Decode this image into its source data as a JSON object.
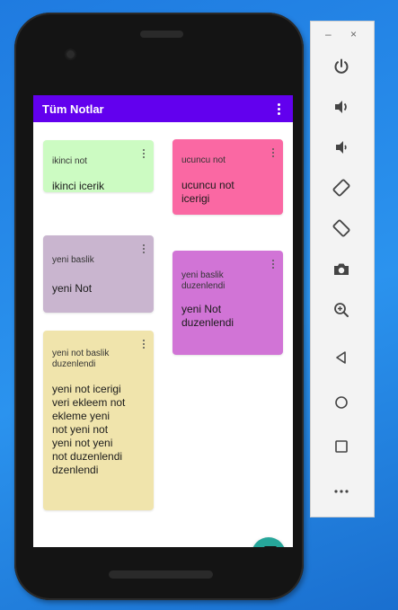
{
  "app": {
    "title": "Tüm Notlar"
  },
  "notes": [
    {
      "title": "ikinci not",
      "body": "ikinci icerik",
      "color": "#ccfbc2"
    },
    {
      "title": "ucuncu not",
      "body": "ucuncu not\nicerigi",
      "color": "#fa68a3"
    },
    {
      "title": "yeni baslik",
      "body": "yeni Not",
      "color": "#c9b5cf"
    },
    {
      "title": "yeni baslik\nduzenlendi",
      "body": "yeni Not\nduzenlendi",
      "color": "#d174d6"
    },
    {
      "title": "yeni not baslik\nduzenlendi",
      "body": "yeni not icerigi\nveri ekleem not\nekleme yeni\nnot yeni not\nyeni not yeni\nnot duzenlendi\ndzenlendi",
      "color": "#f0e4ac"
    }
  ],
  "window_controls": {
    "minimize": "–",
    "close": "×"
  },
  "colors": {
    "app_bar": "#6200ee",
    "fab": "#26a69a"
  },
  "toolbar_icons": [
    "power-icon",
    "volume-up-icon",
    "volume-down-icon",
    "rotate-left-icon",
    "rotate-right-icon",
    "camera-icon",
    "zoom-icon",
    "back-icon",
    "home-icon",
    "overview-icon",
    "more-icon"
  ]
}
